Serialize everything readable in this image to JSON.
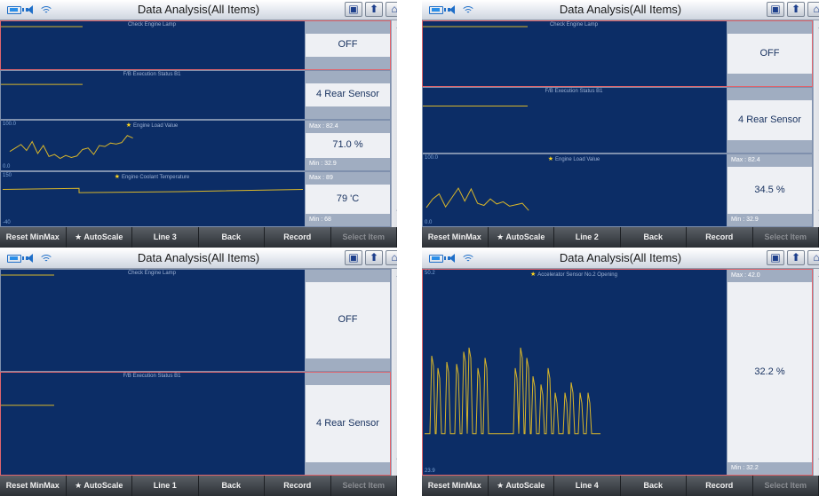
{
  "common": {
    "title": "Data Analysis(All Items)",
    "bottom_buttons": [
      "Reset MinMax",
      "★ AutoScale",
      "Back",
      "Record",
      "Select Item"
    ],
    "colors": {
      "screen_bg": "#0c2d66",
      "trace": "#d9b62a",
      "selected_border": "#e0646c"
    },
    "icons": [
      "battery-icon",
      "speaker-icon",
      "wifi-icon",
      "screenshot-icon",
      "upload-icon",
      "home-icon"
    ],
    "scroll_icons": [
      "double-up-icon",
      "up-icon",
      "down-icon",
      "double-down-icon"
    ]
  },
  "panels": [
    {
      "line_label": "Line 3",
      "rows": [
        {
          "name": "Check Engine Lamp",
          "value": "OFF",
          "star": false,
          "graph": false
        },
        {
          "name": "F/B Execution Status B1",
          "value": "4 Rear Sensor",
          "star": false,
          "graph": false
        },
        {
          "name": "Engine Load Value",
          "value": "71.0 %",
          "star": true,
          "graph": true,
          "axis_max": "100.0",
          "axis_min": "0.0",
          "max_label": "Max : 82.4",
          "min_label": "Min : 32.9"
        },
        {
          "name": "Engine Coolant Temperature",
          "value": "79 'C",
          "star": true,
          "graph": true,
          "axis_max": "150",
          "axis_min": "-40",
          "max_label": "Max :   89",
          "min_label": "Min :   68"
        }
      ]
    },
    {
      "line_label": "Line 2",
      "rows": [
        {
          "name": "Check Engine Lamp",
          "value": "OFF",
          "star": false,
          "graph": false
        },
        {
          "name": "F/B Execution Status B1",
          "value": "4 Rear Sensor",
          "star": false,
          "graph": false
        },
        {
          "name": "Engine Load Value",
          "value": "34.5 %",
          "star": true,
          "graph": true,
          "axis_max": "100.0",
          "axis_min": "0.0",
          "max_label": "Max : 82.4",
          "min_label": "Min : 32.9"
        }
      ]
    },
    {
      "line_label": "Line 1",
      "rows": [
        {
          "name": "Check Engine Lamp",
          "value": "OFF",
          "star": false,
          "graph": false
        },
        {
          "name": "F/B Execution Status B1",
          "value": "4 Rear Sensor",
          "star": false,
          "graph": false
        }
      ]
    },
    {
      "line_label": "Line 4",
      "rows": [
        {
          "name": "Accelerator Sensor No.2 Opening",
          "value": "32.2 %",
          "star": true,
          "graph": true,
          "axis_max": "50.2",
          "axis_min": "23.9",
          "max_label": "Max : 42.0",
          "min_label": "Min : 32.2"
        }
      ]
    }
  ]
}
